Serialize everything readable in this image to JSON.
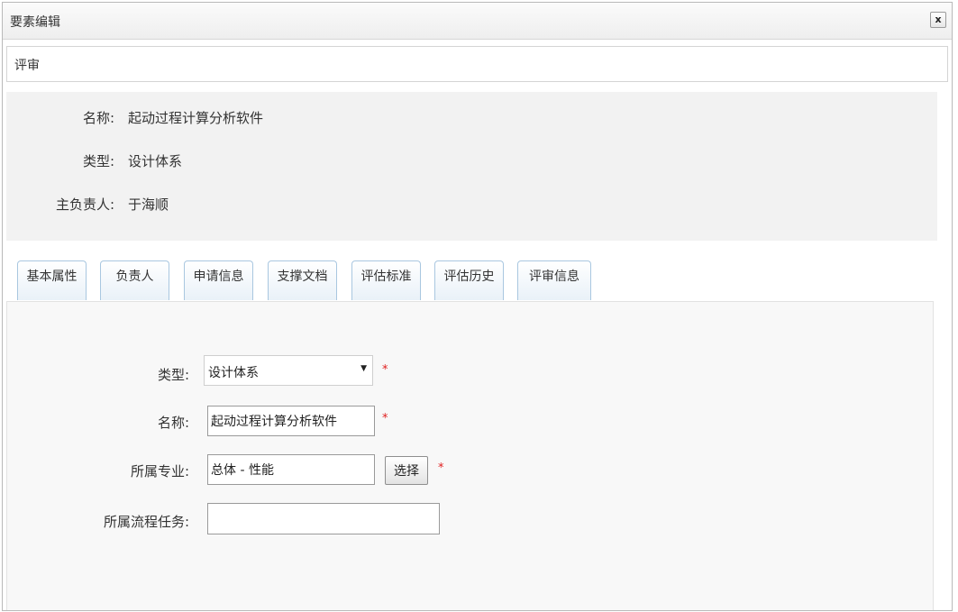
{
  "window": {
    "title": "要素编辑",
    "close_label": "x"
  },
  "section": {
    "title": "评审"
  },
  "info": {
    "name_label": "名称:",
    "name_value": "起动过程计算分析软件",
    "type_label": "类型:",
    "type_value": "设计体系",
    "owner_label": "主负责人:",
    "owner_value": "于海顺"
  },
  "tabs": [
    {
      "label": "基本属性"
    },
    {
      "label": "负责人"
    },
    {
      "label": "申请信息"
    },
    {
      "label": "支撑文档"
    },
    {
      "label": "评估标准"
    },
    {
      "label": "评估历史"
    },
    {
      "label": "评审信息"
    }
  ],
  "form": {
    "type_label": "类型:",
    "type_selected": "设计体系",
    "name_label": "名称:",
    "name_value": "起动过程计算分析软件",
    "specialty_label": "所属专业:",
    "specialty_value": "总体 - 性能",
    "choose_label": "选择",
    "task_label": "所属流程任务:",
    "task_value": "",
    "required_mark": "*"
  },
  "icons": {
    "close": "close-icon",
    "dropdown": "chevron-down-icon"
  }
}
